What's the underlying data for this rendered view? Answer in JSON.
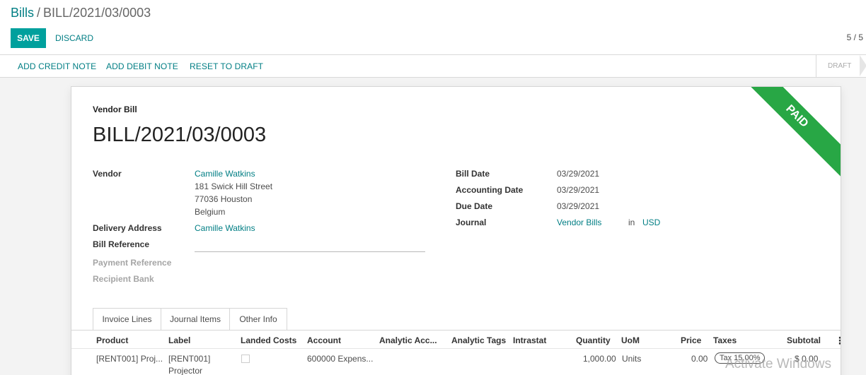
{
  "breadcrumb": {
    "parent": "Bills",
    "separator": "/",
    "current": "BILL/2021/03/0003"
  },
  "buttons": {
    "save": "SAVE",
    "discard": "DISCARD"
  },
  "pager": "5 / 5",
  "statusbar": {
    "add_credit_note": "ADD CREDIT NOTE",
    "add_debit_note": "ADD DEBIT NOTE",
    "reset_to_draft": "RESET TO DRAFT",
    "state": "DRAFT"
  },
  "ribbon": "PAID",
  "form": {
    "doc_type": "Vendor Bill",
    "title": "BILL/2021/03/0003",
    "vendor": {
      "label": "Vendor",
      "name": "Camille Watkins",
      "street": "181 Swick Hill Street",
      "city": "77036 Houston",
      "country": "Belgium"
    },
    "delivery_address": {
      "label": "Delivery Address",
      "value": "Camille Watkins"
    },
    "bill_reference": {
      "label": "Bill Reference",
      "value": ""
    },
    "payment_reference": {
      "label": "Payment Reference"
    },
    "recipient_bank": {
      "label": "Recipient Bank"
    },
    "bill_date": {
      "label": "Bill Date",
      "value": "03/29/2021"
    },
    "accounting_date": {
      "label": "Accounting Date",
      "value": "03/29/2021"
    },
    "due_date": {
      "label": "Due Date",
      "value": "03/29/2021"
    },
    "journal": {
      "label": "Journal",
      "value": "Vendor Bills",
      "in": "in",
      "currency": "USD"
    }
  },
  "tabs": [
    "Invoice Lines",
    "Journal Items",
    "Other Info"
  ],
  "table": {
    "headers": [
      "Product",
      "Label",
      "Landed Costs",
      "Account",
      "Analytic Acc...",
      "Analytic Tags",
      "Intrastat",
      "Quantity",
      "UoM",
      "Price",
      "Taxes",
      "Subtotal"
    ],
    "rows": [
      {
        "product": "[RENT001] Proj...",
        "label_line1": "[RENT001]",
        "label_line2": "Projector",
        "account": "600000 Expens...",
        "quantity": "1,000.00",
        "uom": "Units",
        "price": "0.00",
        "tax": "Tax 15.00%",
        "subtotal": "$ 0.00"
      }
    ]
  },
  "kebab": "⋮",
  "watermark": "Activate Windows",
  "colors": {
    "accent": "#00a09d",
    "link": "#017e84",
    "ribbon": "#28a745"
  }
}
